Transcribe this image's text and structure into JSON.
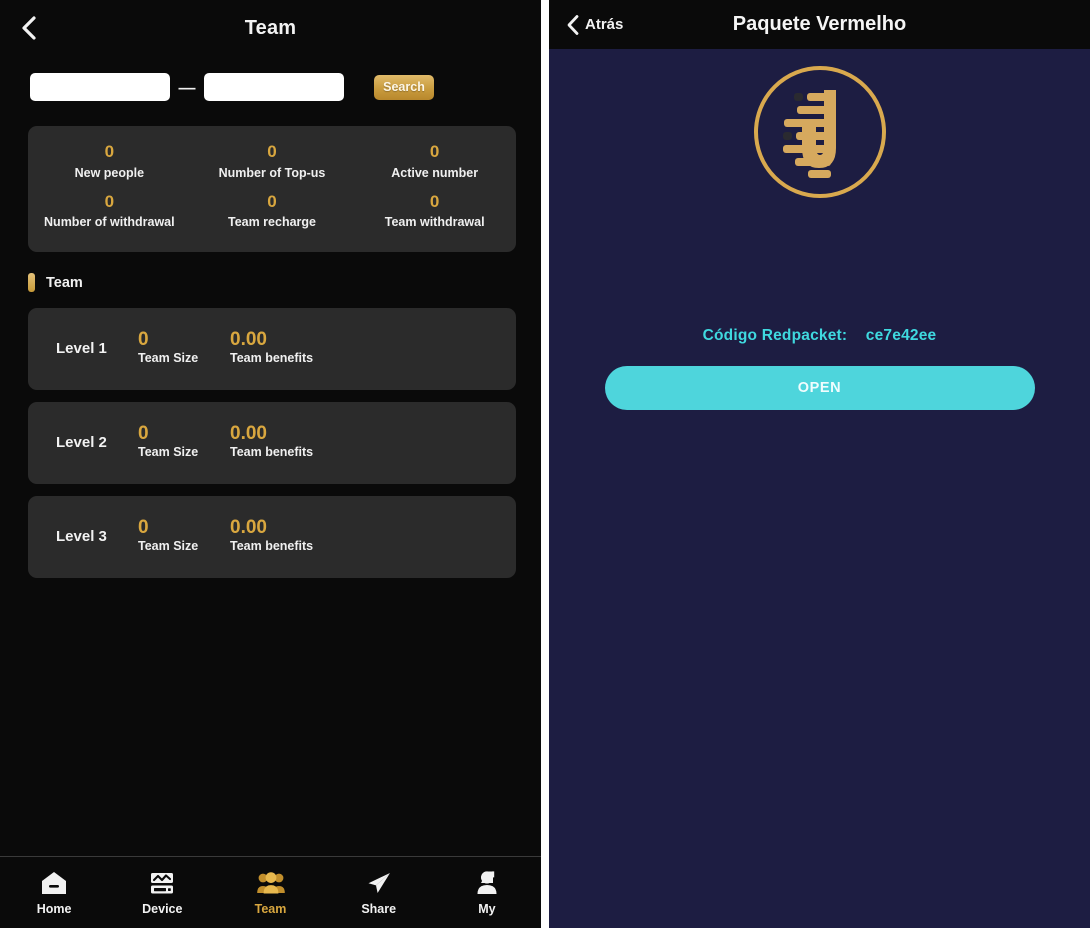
{
  "left": {
    "header": {
      "back_icon": "chevron-left-icon",
      "title": "Team"
    },
    "search": {
      "from_value": "",
      "from_placeholder": "",
      "separator": "—",
      "to_value": "",
      "to_placeholder": "",
      "button_label": "Search"
    },
    "stats": [
      {
        "value": "0",
        "label": "New people"
      },
      {
        "value": "0",
        "label": "Number of Top-us"
      },
      {
        "value": "0",
        "label": "Active number"
      },
      {
        "value": "0",
        "label": "Number of withdrawal"
      },
      {
        "value": "0",
        "label": "Team recharge"
      },
      {
        "value": "0",
        "label": "Team withdrawal"
      }
    ],
    "section": {
      "title": "Team"
    },
    "levels": [
      {
        "name": "Level 1",
        "size_value": "0",
        "size_label": "Team Size",
        "benefits_value": "0.00",
        "benefits_label": "Team benefits"
      },
      {
        "name": "Level 2",
        "size_value": "0",
        "size_label": "Team Size",
        "benefits_value": "0.00",
        "benefits_label": "Team benefits"
      },
      {
        "name": "Level 3",
        "size_value": "0",
        "size_label": "Team Size",
        "benefits_value": "0.00",
        "benefits_label": "Team benefits"
      }
    ],
    "nav": [
      {
        "label": "Home",
        "icon": "home-icon",
        "active": false
      },
      {
        "label": "Device",
        "icon": "device-icon",
        "active": false
      },
      {
        "label": "Team",
        "icon": "team-icon",
        "active": true
      },
      {
        "label": "Share",
        "icon": "share-icon",
        "active": false
      },
      {
        "label": "My",
        "icon": "user-icon",
        "active": false
      }
    ]
  },
  "right": {
    "header": {
      "back_icon": "chevron-left-icon",
      "back_label": "Atrás",
      "title": "Paquete Vermelho"
    },
    "logo": {
      "icon": "brand-u-logo-icon"
    },
    "code": {
      "label": "Código Redpacket:",
      "value": "ce7e42ee"
    },
    "open_button": {
      "label": "OPEN"
    }
  },
  "colors": {
    "gold": "#d9a73f",
    "card_bg": "#2b2b2b",
    "panel_bg": "#0a0a0a",
    "navy_bg": "#1d1d42",
    "cyan": "#3fd9df",
    "turquoise": "#4ed5dc"
  }
}
